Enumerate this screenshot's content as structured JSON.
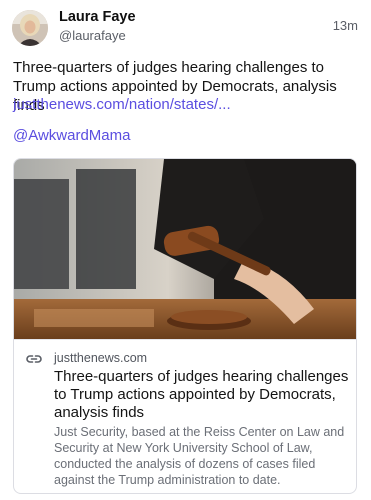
{
  "post": {
    "author": {
      "name": "Laura Faye",
      "handle": "@laurafaye"
    },
    "timestamp": "13m",
    "text": "Three-quarters of judges hearing challenges to Trump actions appointed by Democrats, analysis finds",
    "link_text": "justthenews.com/nation/states/...",
    "mention": "@AwkwardMama"
  },
  "link_card": {
    "domain": "justthenews.com",
    "title": "Three-quarters of judges hearing challenges to Trump actions appointed by Democrats, analysis finds",
    "description": "Just Security, based at the Reiss Center on Law and Security at New York University School of Law, conducted the analysis of dozens of cases filed against the Trump administration to date.",
    "image_subject": "judge-gavel-photo"
  },
  "colors": {
    "link": "#5b4ee0",
    "muted_text": "#5a5e66",
    "card_border": "#dcdde3"
  }
}
